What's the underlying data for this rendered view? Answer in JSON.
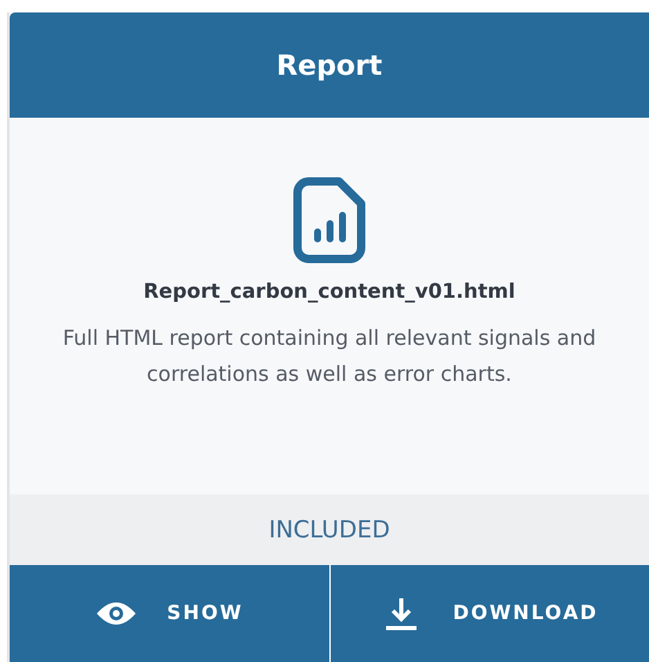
{
  "card": {
    "title": "Report",
    "file_name": "Report_carbon_content_v01.html",
    "description": "Full HTML report containing all relevant signals and correlations as well as error charts.",
    "status": "INCLUDED",
    "actions": [
      {
        "kind": "view",
        "label": "SHOW"
      },
      {
        "kind": "download",
        "label": "DOWNLOAD"
      }
    ]
  }
}
